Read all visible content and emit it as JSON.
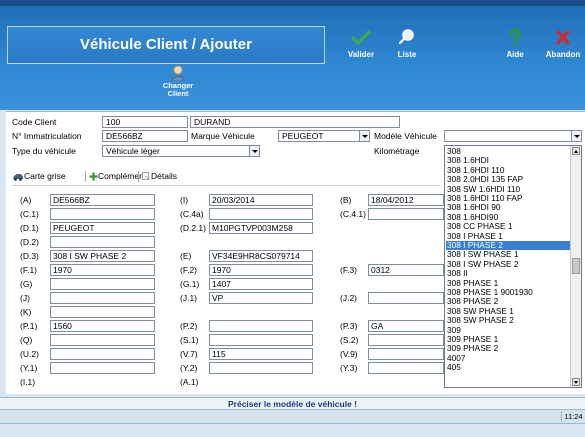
{
  "header": {
    "title": "Véhicule Client / Ajouter",
    "buttons": {
      "valider": "Valider",
      "liste": "Liste",
      "aide": "Aide",
      "abandon": "Abandon"
    },
    "changer_client": [
      "Changer",
      "Client"
    ],
    "colors": {
      "accent": "#2f86d0",
      "valider_icon": "#3fb03f",
      "aide_icon": "#2e9a2e",
      "abandon_icon": "#d8262a"
    }
  },
  "form": {
    "code_client_label": "Code Client",
    "code_client": "100",
    "client_name": "DURAND",
    "immat_label": "N° Immatriculation",
    "immat": "DE566BZ",
    "marque_label": "Marque Véhicule",
    "marque": "PEUGEOT",
    "modele_label": "Modèle Véhicule",
    "modele": "",
    "type_label": "Type du véhicule",
    "type": "Véhicule léger",
    "km_label": "Kilométrage"
  },
  "tabs": [
    {
      "label": "Carte grise",
      "icon": "car-icon"
    },
    {
      "label": "Complément",
      "icon": "plus-icon"
    },
    {
      "label": "Détails",
      "icon": "detail-icon"
    }
  ],
  "card": {
    "col1": [
      {
        "code": "(A)",
        "value": "DE566BZ"
      },
      {
        "code": "(C.1)",
        "value": ""
      },
      {
        "code": "(D.1)",
        "value": "PEUGEOT"
      },
      {
        "code": "(D.2)",
        "value": ""
      },
      {
        "code": "(D.3)",
        "value": "308 I SW PHASE 2"
      },
      {
        "code": "(F.1)",
        "value": "1970"
      },
      {
        "code": "(G)",
        "value": ""
      },
      {
        "code": "(J)",
        "value": ""
      },
      {
        "code": "(K)",
        "value": ""
      },
      {
        "code": "(P.1)",
        "value": "1560"
      },
      {
        "code": "(Q)",
        "value": ""
      },
      {
        "code": "(U.2)",
        "value": ""
      },
      {
        "code": "(Y.1)",
        "value": ""
      },
      {
        "code": "(I.1)",
        "value": ""
      }
    ],
    "col2": [
      {
        "code": "(I)",
        "value": "20/03/2014"
      },
      {
        "code": "(C.4a)",
        "value": ""
      },
      {
        "code": "(D.2.1)",
        "value": "M10PGTVP003M258"
      },
      {
        "code": "(E)",
        "value": "VF34E9HR8CS079714"
      },
      {
        "code": "(F.2)",
        "value": "1970"
      },
      {
        "code": "(G.1)",
        "value": "1407"
      },
      {
        "code": "(J.1)",
        "value": "VP"
      },
      {
        "code": "(P.2)",
        "value": ""
      },
      {
        "code": "(S.1)",
        "value": ""
      },
      {
        "code": "(V.7)",
        "value": "115"
      },
      {
        "code": "(Y.2)",
        "value": ""
      },
      {
        "code": "(A.1)",
        "value": ""
      }
    ],
    "col3": [
      {
        "code": "(B)",
        "value": "18/04/2012"
      },
      {
        "code": "(C.4.1)",
        "value": ""
      },
      {
        "code": "(F.3)",
        "value": "0312"
      },
      {
        "code": "(J.2)",
        "value": ""
      },
      {
        "code": "(P.3)",
        "value": "GA"
      },
      {
        "code": "(S.2)",
        "value": ""
      },
      {
        "code": "(V.9)",
        "value": ""
      },
      {
        "code": "(Y.3)",
        "value": ""
      }
    ]
  },
  "dropdown": {
    "items": [
      "308",
      "308 1.6HDI",
      "308 1.6HDI 110",
      "308 2.0HDI 135 FAP",
      "308 SW 1.6HDI 110",
      "308 1.6HDI 110 FAP",
      "308 1.6HDI 90",
      "308 1.6HDI90",
      "308 CC PHASE 1",
      "308 I PHASE 1",
      "308 I PHASE 2",
      "308 I SW PHASE 1",
      "308 I SW PHASE 2",
      "308 II",
      "308 PHASE 1",
      "308 PHASE 1 9001930",
      "308 PHASE 2",
      "308 SW PHASE 1",
      "308 SW PHASE 2",
      "309",
      "309 PHASE 1",
      "309 PHASE 2",
      "4007",
      "405"
    ],
    "selected_index": 10,
    "selected_color": "#3a7fd4"
  },
  "status": {
    "message": "Préciser le modèle de véhicule !",
    "time": "11:24"
  }
}
